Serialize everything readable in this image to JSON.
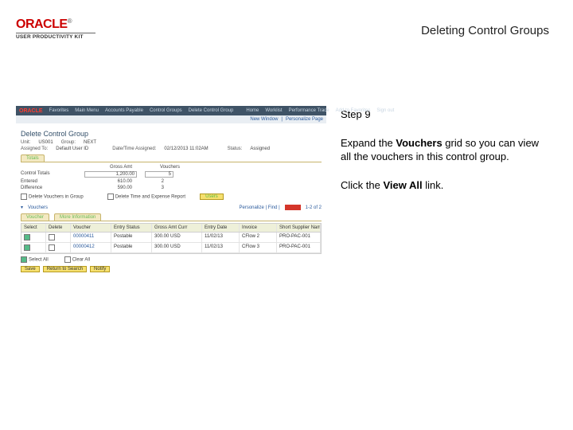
{
  "header": {
    "title": "Deleting Control Groups"
  },
  "logo": {
    "brand": "ORACLE",
    "tm": "®",
    "sub": "USER PRODUCTIVITY KIT"
  },
  "step": {
    "label": "Step 9"
  },
  "instruction": {
    "pre": "Expand the ",
    "bold1": "Vouchers",
    "mid": " grid so you can view all the vouchers in this control group.",
    "click_pre": "Click the ",
    "click_bold": "View All",
    "click_post": " link."
  },
  "shot": {
    "tabbar": {
      "brand": "ORACLE",
      "items": [
        "Favorites",
        "Main Menu",
        "Accounts Payable",
        "Control Groups",
        "Delete Control Group"
      ],
      "right": [
        "Home",
        "Worklist",
        "Performance Trace",
        "Add to Favorites",
        "Sign out"
      ]
    },
    "crumb": {
      "newwin": "New Window",
      "pers": "Personalize Page"
    },
    "h1": "Delete Control Group",
    "unit_lbl": "Unit:",
    "unit_val": "US001",
    "group_lbl": "Group:",
    "group_val": "NEXT",
    "assigned_lbl": "Assigned To:",
    "assigned_val": "Default User ID",
    "date_lbl": "Date/Time Assigned:",
    "date_val": "02/12/2013 11:02AM",
    "status_lbl": "Status:",
    "status_val": "Assigned",
    "totals_tab": "Totals",
    "th_gross": "Gross Amt",
    "th_vch": "Vouchers",
    "r1": "Control Totals",
    "r1a": "1,200.00",
    "r1b": "5",
    "r2": "Entered",
    "r2a": "610.00",
    "r2b": "2",
    "r3": "Difference",
    "r3a": "590.00",
    "r3b": "3",
    "chk1": "Delete Vouchers in Group",
    "chk2": "Delete Time and Expense Report",
    "userbtn": "Users",
    "v_title": "Vouchers",
    "v_pers": "Personalize | Find |",
    "v_count": "1-2 of 2",
    "gtabs": [
      "Voucher",
      "More Information"
    ],
    "gcols": [
      "Select",
      "Delete",
      "Voucher",
      "Entry Status",
      "Gross Amt Curr",
      "Entry Date",
      "Invoice",
      "Short Supplier Name"
    ],
    "grows": [
      [
        "",
        "",
        "00000411",
        "Postable",
        "300.00 USD",
        "11/02/13",
        "CFlow 2",
        "PRO-PAC-001"
      ],
      [
        "",
        "",
        "00000412",
        "Postable",
        "300.00 USD",
        "11/02/13",
        "CFlow 3",
        "PRO-PAC-001"
      ]
    ],
    "btns": [
      "Save",
      "Return to Search",
      "Notify"
    ]
  }
}
